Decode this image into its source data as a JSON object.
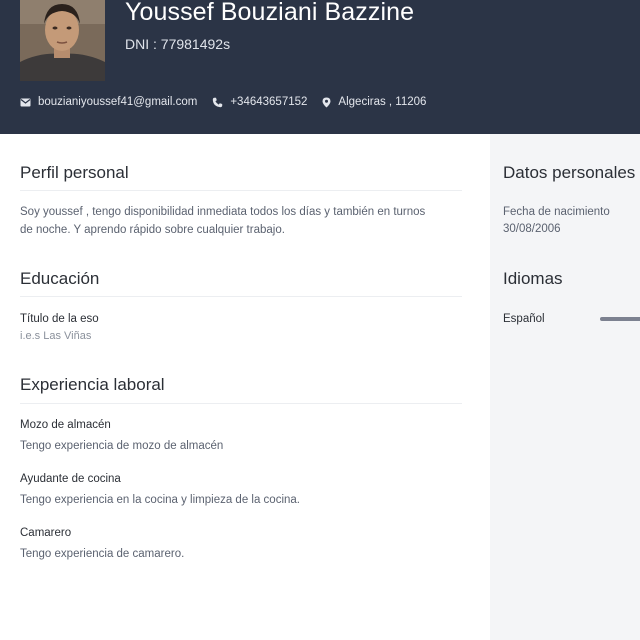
{
  "header": {
    "name": "Youssef Bouziani Bazzine",
    "dni": "DNI : 77981492s",
    "contacts": {
      "email": "bouzianiyoussef41@gmail.com",
      "phone": "+34643657152",
      "location": "Algeciras , 11206"
    },
    "icons": {
      "email": "envelope-icon",
      "phone": "phone-icon",
      "location": "location-pin-icon"
    },
    "colors": {
      "header_bg": "#2b3446",
      "sidebar_bg": "#f4f5f7"
    }
  },
  "main": {
    "perfil": {
      "title": "Perfil personal",
      "line1": "Soy youssef , tengo disponibilidad inmediata todos los días y también en turnos",
      "line2": "de noche. Y aprendo rápido sobre cualquier trabajo."
    },
    "educacion": {
      "title": "Educación",
      "degree": "Título de la eso",
      "school": "i.e.s Las Viñas"
    },
    "experiencia": {
      "title": "Experiencia laboral",
      "jobs": [
        {
          "role": "Mozo de almacén",
          "desc": "Tengo experiencia de mozo de almacén"
        },
        {
          "role": "Ayudante de cocina",
          "desc": "Tengo experiencia en la cocina y limpieza de la cocina."
        },
        {
          "role": "Camarero",
          "desc": "Tengo experiencia de camarero."
        }
      ]
    }
  },
  "sidebar": {
    "datos": {
      "title": "Datos personales",
      "birth_label": "Fecha de nacimiento",
      "birth_value": "30/08/2006"
    },
    "idiomas": {
      "title": "Idiomas",
      "languages": [
        {
          "name": "Español"
        }
      ]
    }
  }
}
